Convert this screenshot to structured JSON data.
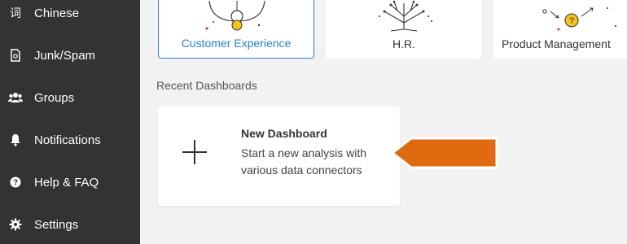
{
  "sidebar": {
    "items": [
      {
        "label": "Chinese",
        "icon": "chinese-character-icon"
      },
      {
        "label": "Junk/Spam",
        "icon": "document-icon"
      },
      {
        "label": "Groups",
        "icon": "users-icon"
      },
      {
        "label": "Notifications",
        "icon": "bell-icon"
      },
      {
        "label": "Help & FAQ",
        "icon": "question-circle-icon"
      },
      {
        "label": "Settings",
        "icon": "gear-icon"
      }
    ],
    "chinese_glyph": "词"
  },
  "templates": [
    {
      "label": "Customer Experience",
      "selected": true
    },
    {
      "label": "H.R.",
      "selected": false
    },
    {
      "label": "Product Management",
      "selected": false
    }
  ],
  "recent": {
    "title": "Recent Dashboards",
    "new_dashboard": {
      "title": "New Dashboard",
      "description": "Start a new analysis with various data connectors"
    }
  },
  "colors": {
    "sidebar_bg": "#333333",
    "accent_blue": "#2a7fd6",
    "callout_orange": "#e06a10"
  }
}
